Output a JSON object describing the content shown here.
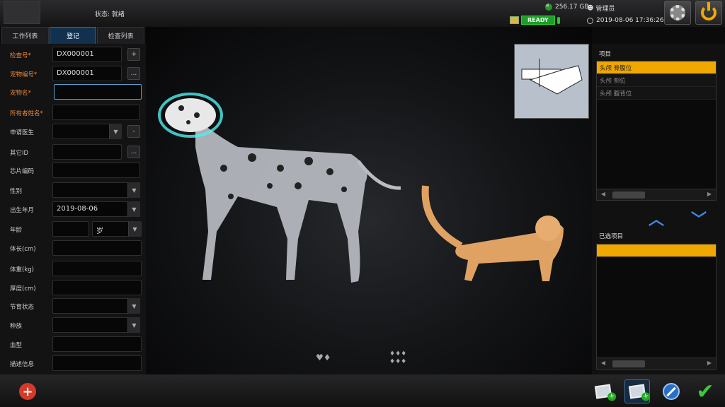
{
  "header": {
    "status": "状态: 就绪",
    "disk": "256.17 GB",
    "user": "管理员",
    "ready": "READY",
    "datetime": "2019-08-06 17:36:26"
  },
  "tabs": [
    "工作列表",
    "登记",
    "检查列表"
  ],
  "active_tab": "登记",
  "form": {
    "exam_no": {
      "label": "检查号*",
      "value": "DX000001"
    },
    "pet_no": {
      "label": "宠物编号*",
      "value": "DX000001"
    },
    "pet_name": {
      "label": "宠物名*",
      "value": ""
    },
    "owner_name": {
      "label": "所有者姓名*",
      "value": ""
    },
    "doctor": {
      "label": "申请医生",
      "value": ""
    },
    "other_id": {
      "label": "其它ID",
      "value": ""
    },
    "chip": {
      "label": "芯片编码",
      "value": ""
    },
    "sex": {
      "label": "性别",
      "value": ""
    },
    "birth": {
      "label": "出生年月",
      "value": "2019-08-06"
    },
    "age": {
      "label": "年龄",
      "value": "",
      "unit": "岁"
    },
    "length": {
      "label": "体长(cm)",
      "value": ""
    },
    "weight": {
      "label": "体重(kg)",
      "value": ""
    },
    "thickness": {
      "label": "厚度(cm)",
      "value": ""
    },
    "neuter": {
      "label": "节育状态",
      "value": ""
    },
    "breed": {
      "label": "种族",
      "value": ""
    },
    "blood": {
      "label": "血型",
      "value": ""
    },
    "desc": {
      "label": "描述信息",
      "value": ""
    }
  },
  "buttons": {
    "add": "+",
    "more": "...",
    "minus": "-"
  },
  "right": {
    "items_title": "项目",
    "items": [
      "头颅 脊腹位",
      "头颅 侧位",
      "头颅 腹背位"
    ],
    "selected_title": "已选项目",
    "up": "︿",
    "down": "﹀"
  },
  "colors": {
    "accent": "#f0a800",
    "tab_active": "#12314f",
    "required": "#e7883b",
    "ready": "#1e9e2a"
  }
}
